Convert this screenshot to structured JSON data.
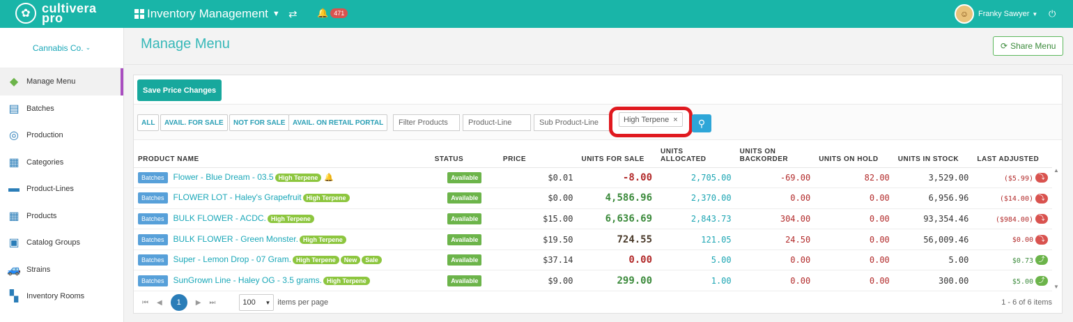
{
  "brand": {
    "line1": "cultivera",
    "line2": "pro"
  },
  "topbar": {
    "module": "Inventory Management",
    "notifications": "471",
    "user_name": "Franky Sawyer"
  },
  "sidebar": {
    "company": "Cannabis Co.",
    "items": [
      {
        "label": "Manage Menu",
        "icon": "tag-icon"
      },
      {
        "label": "Batches",
        "icon": "clipboard-icon"
      },
      {
        "label": "Production",
        "icon": "production-icon"
      },
      {
        "label": "Categories",
        "icon": "table-icon"
      },
      {
        "label": "Product-Lines",
        "icon": "layout-icon"
      },
      {
        "label": "Products",
        "icon": "grid-icon"
      },
      {
        "label": "Catalog Groups",
        "icon": "catalog-icon"
      },
      {
        "label": "Strains",
        "icon": "car-icon"
      },
      {
        "label": "Inventory Rooms",
        "icon": "rooms-icon"
      }
    ]
  },
  "header": {
    "title": "Manage Menu",
    "share": "Share Menu"
  },
  "toolbar": {
    "save": "Save Price Changes"
  },
  "filters": {
    "all": "ALL",
    "avail_sale": "AVAIL. FOR SALE",
    "not_sale": "NOT FOR SALE",
    "avail_retail": "AVAIL. ON RETAIL PORTAL",
    "filter_placeholder": "Filter Products",
    "product_line": "Product-Line",
    "sub_product_line": "Sub Product-Line",
    "tag": "High Terpene"
  },
  "table": {
    "headers": {
      "name": "PRODUCT NAME",
      "status": "STATUS",
      "price": "PRICE",
      "ufs": "UNITS FOR SALE",
      "alloc_1": "UNITS",
      "alloc_2": "ALLOCATED",
      "back_1": "UNITS ON",
      "back_2": "BACKORDER",
      "hold": "UNITS ON HOLD",
      "stock": "UNITS IN STOCK",
      "adj": "LAST ADJUSTED"
    },
    "rows": [
      {
        "type": "Batches",
        "name": "Flower - Blue Dream - 03.5",
        "labels": [
          "High Terpene"
        ],
        "status": "Available",
        "price": "$0.01",
        "ufs": "-8.00",
        "allocated": "2,705.00",
        "backorder": "-69.00",
        "hold": "82.00",
        "stock": "3,529.00",
        "adj": "($5.99)"
      },
      {
        "type": "Batches",
        "name": "FLOWER LOT - Haley's Grapefruit",
        "labels": [
          "High Terpene"
        ],
        "status": "Available",
        "price": "$0.00",
        "ufs": "4,586.96",
        "allocated": "2,370.00",
        "backorder": "0.00",
        "hold": "0.00",
        "stock": "6,956.96",
        "adj": "($14.00)"
      },
      {
        "type": "Batches",
        "name": "BULK FLOWER - ACDC.",
        "labels": [
          "High Terpene"
        ],
        "status": "Available",
        "price": "$15.00",
        "ufs": "6,636.69",
        "allocated": "2,843.73",
        "backorder": "304.00",
        "hold": "0.00",
        "stock": "93,354.46",
        "adj": "($984.00)"
      },
      {
        "type": "Batches",
        "name": "BULK FLOWER - Green Monster.",
        "labels": [
          "High Terpene"
        ],
        "status": "Available",
        "price": "$19.50",
        "ufs": "724.55",
        "allocated": "121.05",
        "backorder": "24.50",
        "hold": "0.00",
        "stock": "56,009.46",
        "adj": "$0.00"
      },
      {
        "type": "Batches",
        "name": "Super - Lemon Drop - 07 Gram.",
        "labels": [
          "High Terpene",
          "New",
          "Sale"
        ],
        "status": "Available",
        "price": "$37.14",
        "ufs": "0.00",
        "allocated": "5.00",
        "backorder": "0.00",
        "hold": "0.00",
        "stock": "5.00",
        "adj": "$0.73"
      },
      {
        "type": "Batches",
        "name": "SunGrown Line - Haley OG - 3.5 grams.",
        "labels": [
          "High Terpene"
        ],
        "status": "Available",
        "price": "$9.00",
        "ufs": "299.00",
        "allocated": "1.00",
        "backorder": "0.00",
        "hold": "0.00",
        "stock": "300.00",
        "adj": "$5.00"
      }
    ]
  },
  "pager": {
    "page": "1",
    "size": "100",
    "ipp": "items per page",
    "range": "1 - 6 of 6 items"
  }
}
